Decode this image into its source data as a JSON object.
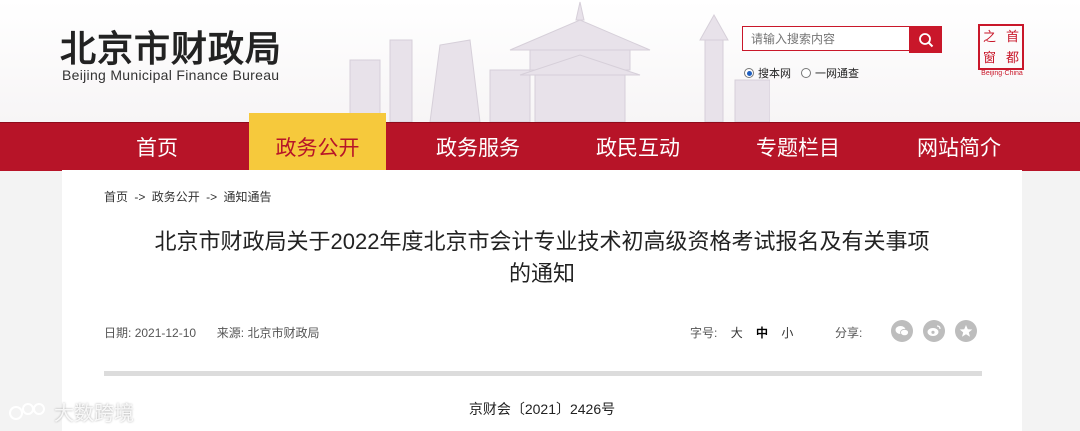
{
  "site": {
    "name_cn": "北京市财政局",
    "name_en": "Beijing Municipal Finance Bureau",
    "seal_chars": [
      "首",
      "都",
      "之",
      "窗"
    ],
    "seal_en": "Beijing·China"
  },
  "search": {
    "placeholder": "请输入搜索内容",
    "scope_options": [
      "搜本网",
      "一网通查"
    ],
    "selected_scope": "搜本网"
  },
  "nav": {
    "items": [
      "首页",
      "政务公开",
      "政务服务",
      "政民互动",
      "专题栏目",
      "网站简介"
    ],
    "active": "政务公开"
  },
  "breadcrumb": [
    "首页",
    "政务公开",
    "通知通告"
  ],
  "breadcrumb_sep": "->",
  "article": {
    "title_line1": "北京市财政局关于2022年度北京市会计专业技术初高级资格考试报名及有关事项",
    "title_line2": "的通知",
    "date_label": "日期:",
    "date": "2021-12-10",
    "source_label": "来源:",
    "source": "北京市财政局",
    "fontsize_label": "字号:",
    "fontsizes": [
      "大",
      "中",
      "小"
    ],
    "share_label": "分享:",
    "doc_number": "京财会〔2021〕2426号"
  },
  "watermark": "大数跨境",
  "colors": {
    "brand_red": "#b71428",
    "active_tab": "#f6c93c"
  }
}
